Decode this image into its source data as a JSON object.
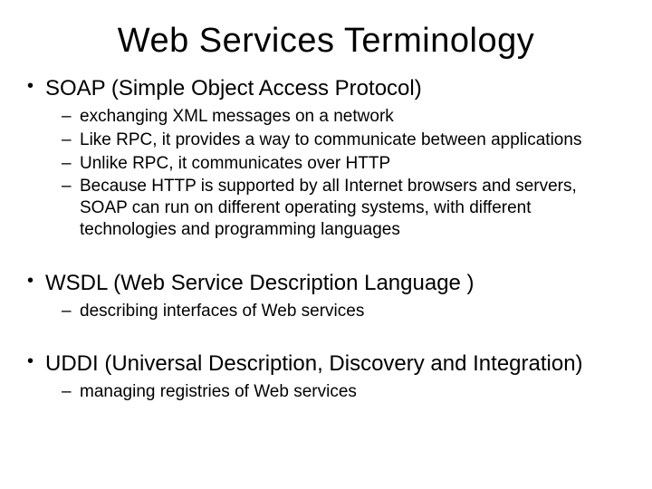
{
  "title": "Web Services Terminology",
  "items": [
    {
      "label": "SOAP (Simple Object Access Protocol)",
      "sub": [
        "exchanging XML messages on a network",
        "Like RPC, it provides a way to communicate between applications",
        "Unlike RPC, it communicates over HTTP",
        "Because HTTP is supported by all Internet browsers and servers, SOAP can run on different operating systems, with different technologies and programming languages"
      ]
    },
    {
      "label": "WSDL (Web Service Description Language )",
      "sub": [
        "describing interfaces of Web services"
      ]
    },
    {
      "label": "UDDI (Universal Description, Discovery and Integration)",
      "sub": [
        "managing registries of Web services"
      ]
    }
  ]
}
